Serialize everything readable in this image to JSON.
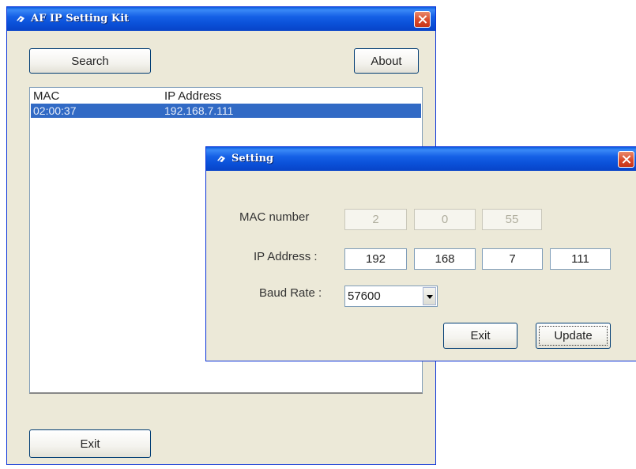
{
  "main_window": {
    "title": "AF IP Setting Kit",
    "search_label": "Search",
    "about_label": "About",
    "exit_label": "Exit",
    "list": {
      "columns": [
        "MAC",
        "IP Address"
      ],
      "rows": [
        {
          "mac": "02:00:37",
          "ip": "192.168.7.111",
          "selected": true
        }
      ]
    }
  },
  "setting_dialog": {
    "title": "Setting",
    "mac_label": "MAC number",
    "mac_values": [
      "2",
      "0",
      "55"
    ],
    "ip_label": "IP Address :",
    "ip_values": [
      "192",
      "168",
      "7",
      "111"
    ],
    "baud_label": "Baud Rate :",
    "baud_value": "57600",
    "exit_label": "Exit",
    "update_label": "Update"
  },
  "colors": {
    "titlebar": "#0a50d8",
    "selection": "#316ac5",
    "window_face": "#ece9d8",
    "close_button": "#d94a2a"
  }
}
